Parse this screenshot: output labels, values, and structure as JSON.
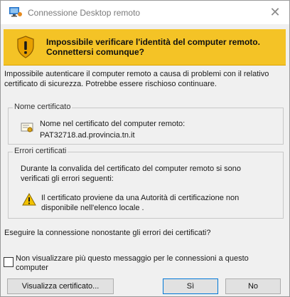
{
  "window": {
    "title": "Connessione Desktop remoto",
    "close_glyph": "✕"
  },
  "banner": {
    "line1": "Impossibile verificare l'identità del computer remoto.",
    "line2": "Connettersi comunque?",
    "icon": "shield-warning-icon",
    "color": "#f4c326"
  },
  "intro": {
    "text": "Impossibile autenticare il computer remoto a causa di problemi con il relativo certificato di sicurezza. Potrebbe essere rischioso continuare."
  },
  "cert_group": {
    "title": "Nome certificato",
    "name_label": "Nome nel certificato del computer remoto:",
    "name_value": "PAT32718.ad.provincia.tn.it",
    "icon": "certificate-icon"
  },
  "errors_group": {
    "title": "Errori certificati",
    "description": "Durante la convalida del certificato del computer remoto si sono verificati gli errori seguenti:",
    "items": [
      {
        "icon": "warning-icon",
        "text": "Il certificato proviene da una Autorità di certificazione non disponibile nell'elenco locale ."
      }
    ]
  },
  "question": "Eseguire la connessione nonostante gli errori dei certificati?",
  "dont_show": {
    "label": "Non visualizzare più questo messaggio per le connessioni a questo computer",
    "checked": false
  },
  "buttons": {
    "view_cert": "Visualizza certificato...",
    "yes": "Sì",
    "no": "No"
  }
}
